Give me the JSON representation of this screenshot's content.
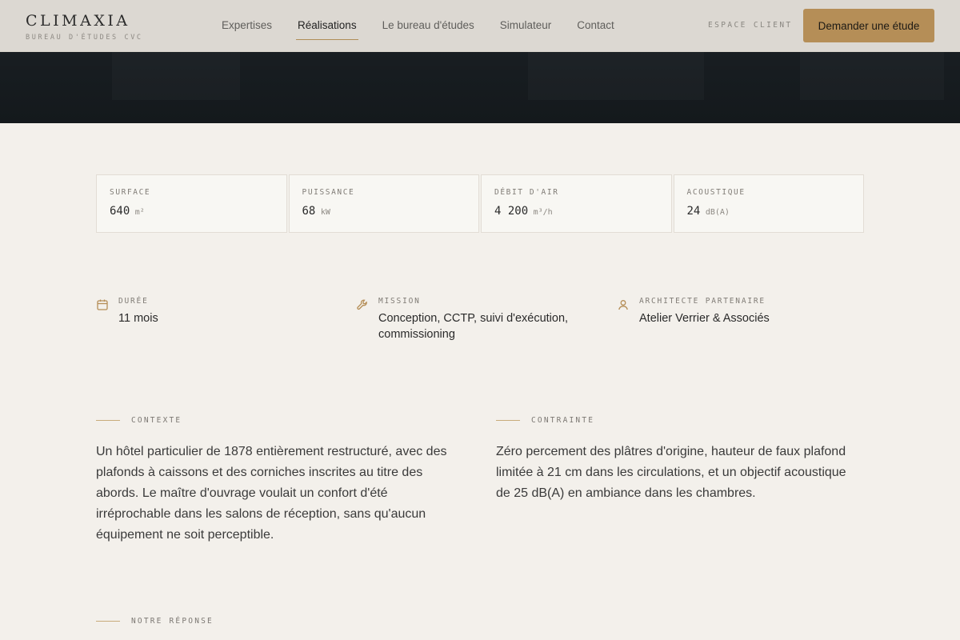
{
  "header": {
    "brand_name": "CLIMAXIA",
    "brand_sub": "BUREAU D'ÉTUDES CVC",
    "nav": [
      {
        "label": "Expertises"
      },
      {
        "label": "Réalisations"
      },
      {
        "label": "Le bureau d'études"
      },
      {
        "label": "Simulateur"
      },
      {
        "label": "Contact"
      }
    ],
    "active_nav": "Réalisations",
    "espace_client": "ESPACE CLIENT",
    "cta_label": "Demander une étude"
  },
  "stats": [
    {
      "label": "SURFACE",
      "value": "640",
      "unit": "m²"
    },
    {
      "label": "PUISSANCE",
      "value": "68",
      "unit": "kW"
    },
    {
      "label": "DÉBIT D'AIR",
      "value": "4 200",
      "unit": "m³/h"
    },
    {
      "label": "ACOUSTIQUE",
      "value": "24",
      "unit": "dB(A)"
    }
  ],
  "meta": [
    {
      "icon": "calendar-icon",
      "label": "DURÉE",
      "value": "11 mois"
    },
    {
      "icon": "wrench-icon",
      "label": "MISSION",
      "value": "Conception, CCTP, suivi d'exécution, commissioning"
    },
    {
      "icon": "user-icon",
      "label": "ARCHITECTE PARTENAIRE",
      "value": "Atelier Verrier & Associés"
    }
  ],
  "sections": {
    "contexte": {
      "title": "CONTEXTE",
      "body": "Un hôtel particulier de 1878 entièrement restructuré, avec des plafonds à caissons et des corniches inscrites au titre des abords. Le maître d'ouvrage voulait un confort d'été irréprochable dans les salons de réception, sans qu'aucun équipement ne soit perceptible."
    },
    "contrainte": {
      "title": "CONTRAINTE",
      "body": "Zéro percement des plâtres d'origine, hauteur de faux plafond limitée à 21 cm dans les circulations, et un objectif acoustique de 25 dB(A) en ambiance dans les chambres."
    },
    "reponse": {
      "title": "NOTRE RÉPONSE"
    }
  },
  "colors": {
    "accent": "#b58e57",
    "background": "#f3f0eb",
    "hero": "#171c20"
  }
}
